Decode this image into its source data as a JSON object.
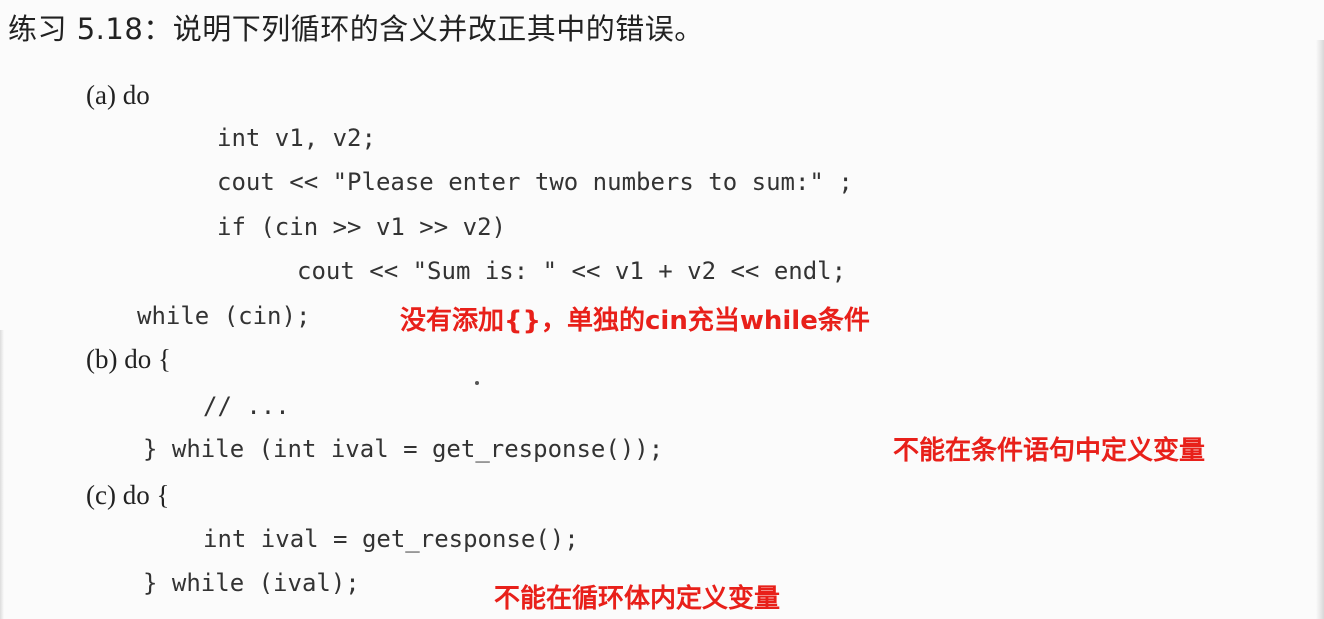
{
  "title": "练习 5.18：说明下列循环的含义并改正其中的错误。",
  "sections": {
    "a": {
      "label": "(a) do",
      "lines": [
        "int v1, v2;",
        "cout << \"Please enter two numbers to sum:\" ;",
        "if (cin >> v1 >> v2)",
        "cout << \"Sum is: \" << v1 + v2 << endl;",
        "while (cin);"
      ],
      "note": "没有添加{}，单独的cin充当while条件"
    },
    "b": {
      "label": "(b) do {",
      "lines": [
        "// ...",
        "} while (int ival = get_response());"
      ],
      "note": "不能在条件语句中定义变量"
    },
    "c": {
      "label": "(c) do {",
      "lines": [
        "int ival = get_response();",
        "} while (ival);"
      ],
      "note": "不能在循环体内定义变量"
    }
  },
  "colors": {
    "note": "#e8201a",
    "text": "#2a2a2a"
  }
}
